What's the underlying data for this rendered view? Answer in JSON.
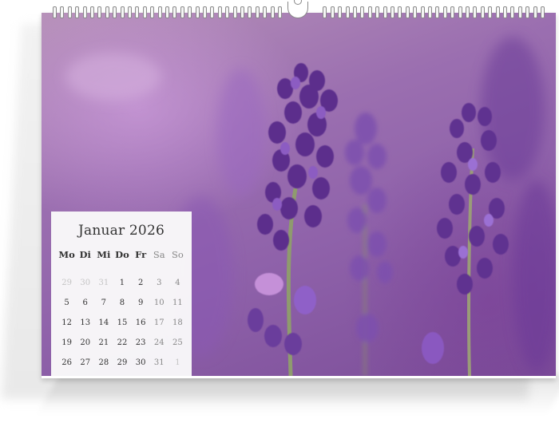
{
  "calendar": {
    "month_title": "Januar 2026",
    "weekdays": [
      "Mo",
      "Di",
      "Mi",
      "Do",
      "Fr",
      "Sa",
      "So"
    ],
    "weeks": [
      [
        "29",
        "30",
        "31",
        "1",
        "2",
        "3",
        "4"
      ],
      [
        "5",
        "6",
        "7",
        "8",
        "9",
        "10",
        "11"
      ],
      [
        "12",
        "13",
        "14",
        "15",
        "16",
        "17",
        "18"
      ],
      [
        "19",
        "20",
        "21",
        "22",
        "23",
        "24",
        "25"
      ],
      [
        "26",
        "27",
        "28",
        "29",
        "30",
        "31",
        "1"
      ]
    ]
  },
  "colors": {
    "lavender_dark": "#5a2e86",
    "lavender_mid": "#7a48a8",
    "lavender_light": "#b28bd0",
    "stem": "#8c9a6a",
    "background": "#9b6fb0"
  },
  "photo": {
    "subject": "lavender-flowers"
  }
}
